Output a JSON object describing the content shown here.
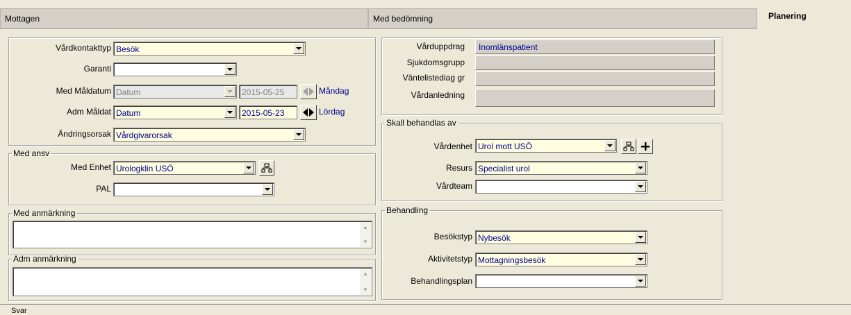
{
  "tabs": [
    "Mottagen",
    "Med bedömning",
    "Planering"
  ],
  "left": {
    "fields": [
      {
        "label": "Vårdkontakttyp",
        "value": "Besök"
      },
      {
        "label": "Garanti",
        "value": ""
      },
      {
        "label": "Med Måldatum",
        "value": "Datum",
        "date": "2015-05-25",
        "day": "Måndag"
      },
      {
        "label": "Adm Måldat",
        "value": "Datum",
        "date": "2015-05-23",
        "day": "Lördag"
      },
      {
        "label": "Ändringsorsak",
        "value": "Vårdgivarorsak"
      }
    ],
    "med_ansv": {
      "legend": "Med ansv",
      "enhet_label": "Med Enhet",
      "enhet_value": "Urologklin USÖ",
      "pal_label": "PAL",
      "pal_value": ""
    },
    "med_anm": {
      "legend": "Med anmärkning"
    },
    "adm_anm": {
      "legend": "Adm anmärkning"
    }
  },
  "right": {
    "info": [
      {
        "label": "Vårduppdrag",
        "value": "Inomlänspatient"
      },
      {
        "label": "Sjukdomsgrupp",
        "value": ""
      },
      {
        "label": "Väntelistediag gr",
        "value": ""
      },
      {
        "label": "Vårdanledning",
        "value": ""
      }
    ],
    "skall": {
      "legend": "Skall behandlas av",
      "fields": [
        {
          "label": "Vårdenhet",
          "value": "Urol mott USÖ"
        },
        {
          "label": "Resurs",
          "value": "Specialist urol"
        },
        {
          "label": "Vårdteam",
          "value": ""
        }
      ]
    },
    "behandling": {
      "legend": "Behandling",
      "fields": [
        {
          "label": "Besökstyp",
          "value": "Nybesök"
        },
        {
          "label": "Aktivitetstyp",
          "value": "Mottagningsbesök"
        },
        {
          "label": "Behandlingsplan",
          "value": ""
        }
      ]
    }
  },
  "bottom": {
    "legend": "Svar"
  }
}
